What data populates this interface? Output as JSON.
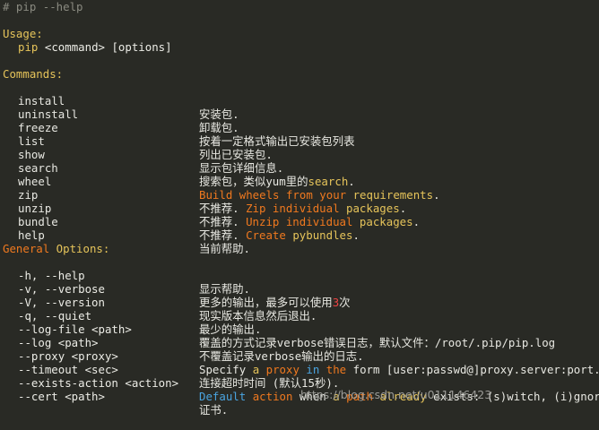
{
  "prompt_line": "# pip --help",
  "usage": {
    "heading": "Usage:",
    "pip": "pip",
    "command": "<command>",
    "options": "[options]"
  },
  "commands": {
    "heading": "Commands:",
    "install": {
      "name": "install",
      "desc": "安装包."
    },
    "uninstall": {
      "name": "uninstall",
      "desc": "卸载包."
    },
    "freeze": {
      "name": "freeze",
      "desc": "按着一定格式输出已安装包列表"
    },
    "list": {
      "name": "list",
      "desc": "列出已安装包."
    },
    "show": {
      "name": "show",
      "desc": "显示包详细信息."
    },
    "search": {
      "name": "search",
      "desc_a": "搜索包，类似yum里的",
      "desc_b": "search",
      "desc_c": "."
    },
    "wheel": {
      "name": "wheel",
      "desc_a": "Build wheels from your ",
      "desc_b": "requirements",
      "desc_c": "."
    },
    "zip": {
      "name": "zip",
      "desc_a": "不推荐. ",
      "desc_b": "Zip individual ",
      "desc_c": "packages",
      "desc_d": "."
    },
    "unzip": {
      "name": "unzip",
      "desc_a": "不推荐. ",
      "desc_b": "Unzip individual ",
      "desc_c": "packages",
      "desc_d": "."
    },
    "bundle": {
      "name": "bundle",
      "desc_a": "不推荐. ",
      "desc_b": "Create ",
      "desc_c": "pybundles",
      "desc_d": "."
    },
    "help": {
      "name": "help",
      "desc": "当前帮助."
    }
  },
  "general": {
    "heading_a": "General",
    "heading_b": " Options:",
    "help": {
      "name": "-h, --help",
      "desc": "显示帮助."
    },
    "verbose": {
      "name": "-v, --verbose",
      "desc_a": "更多的输出，最多可以使用",
      "desc_b": "3",
      "desc_c": "次"
    },
    "version": {
      "name": "-V, --version",
      "desc": "现实版本信息然后退出."
    },
    "quiet": {
      "name": "-q, --quiet",
      "desc": "最少的输出."
    },
    "log_file": {
      "name": "--log-file <path>",
      "desc": "覆盖的方式记录verbose错误日志，默认文件：/root/.pip/pip.log"
    },
    "log": {
      "name": "--log <path>",
      "desc": "不覆盖记录verbose输出的日志."
    },
    "proxy": {
      "name": "--proxy <proxy>",
      "d1": "Specify ",
      "d2": "a ",
      "d3": "proxy ",
      "d4": "in ",
      "d5": "the ",
      "d6": "form [user:passwd@]proxy.server:port."
    },
    "timeout": {
      "name": "--timeout <sec>",
      "desc": "连接超时时间 (默认15秒)."
    },
    "exists_action": {
      "name": "--exists-action <action>",
      "d1": "Default ",
      "d2": "action ",
      "d3": "when ",
      "d4": "a ",
      "d5": "path ",
      "d6": "already ",
      "d7": "exists: (s)witch, (i)gnore,"
    },
    "cert": {
      "name": "--cert <path>",
      "desc": "证书."
    }
  },
  "watermark": "https://blog.csdn.net/u011146423"
}
